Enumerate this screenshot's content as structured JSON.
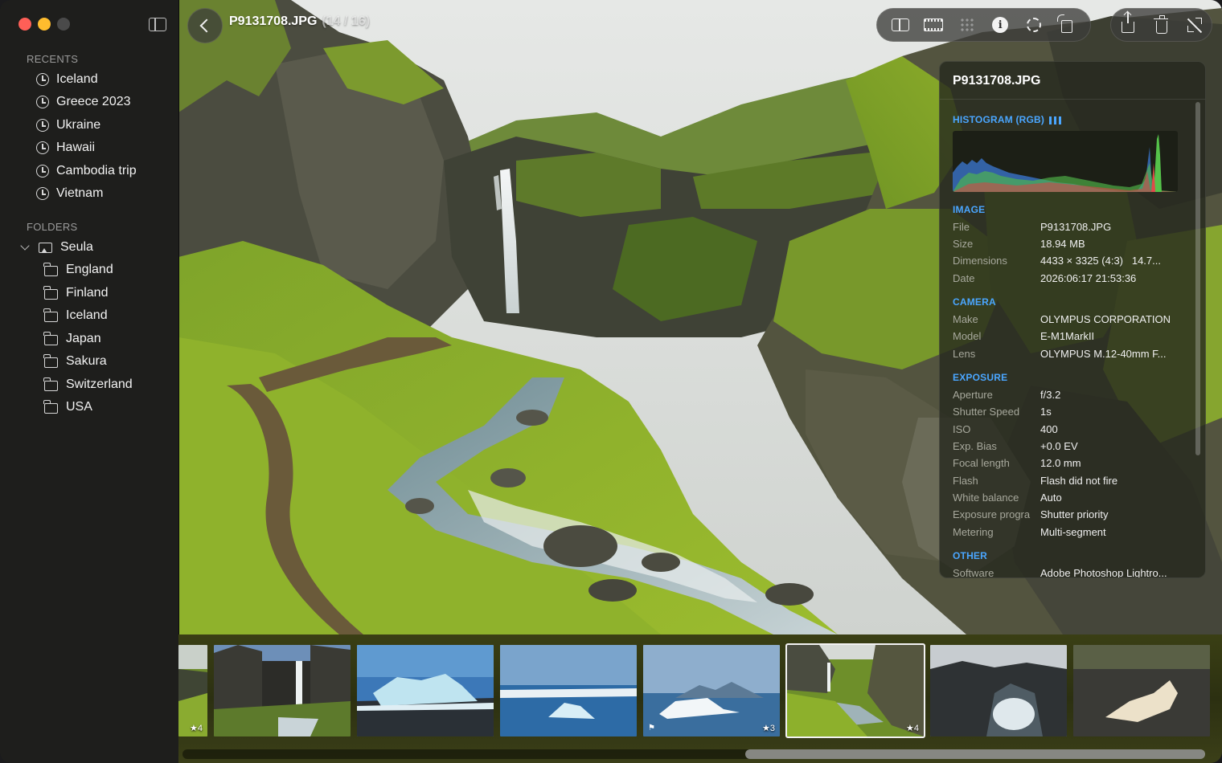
{
  "window": {
    "title": "P9131708.JPG",
    "counter": "(14 / 16)"
  },
  "sidebar": {
    "recents_title": "RECENTS",
    "recents": [
      "Iceland",
      "Greece 2023",
      "Ukraine",
      "Hawaii",
      "Cambodia trip",
      "Vietnam"
    ],
    "folders_title": "FOLDERS",
    "root_folder": "Seula",
    "folders": [
      "England",
      "Finland",
      "Iceland",
      "Japan",
      "Sakura",
      "Switzerland",
      "USA"
    ]
  },
  "toolbar": {
    "view_icons": [
      "split-view-icon",
      "filmstrip-view-icon",
      "grid-view-icon",
      "info-icon",
      "adjust-icon",
      "rotate-icon"
    ],
    "action_icons": [
      "share-icon",
      "trash-icon",
      "fullscreen-icon"
    ]
  },
  "info": {
    "filename": "P9131708.JPG",
    "histogram_title": "HISTOGRAM (RGB)",
    "image_title": "IMAGE",
    "image": [
      {
        "key": "File",
        "value": "P9131708.JPG"
      },
      {
        "key": "Size",
        "value": "18.94 MB"
      },
      {
        "key": "Dimensions",
        "value": "4433 × 3325 (4:3)   14.7..."
      },
      {
        "key": "Date",
        "value": "2026:06:17 21:53:36"
      }
    ],
    "camera_title": "CAMERA",
    "camera": [
      {
        "key": "Make",
        "value": "OLYMPUS CORPORATION"
      },
      {
        "key": "Model",
        "value": "E-M1MarkII"
      },
      {
        "key": "Lens",
        "value": "OLYMPUS M.12-40mm F..."
      }
    ],
    "exposure_title": "EXPOSURE",
    "exposure": [
      {
        "key": "Aperture",
        "value": "f/3.2"
      },
      {
        "key": "Shutter Speed",
        "value": "1s"
      },
      {
        "key": "ISO",
        "value": "400"
      },
      {
        "key": "Exp. Bias",
        "value": "+0.0 EV"
      },
      {
        "key": "Focal length",
        "value": "12.0 mm"
      },
      {
        "key": "Flash",
        "value": "Flash did not fire"
      },
      {
        "key": "White balance",
        "value": "Auto"
      },
      {
        "key": "Exposure progra",
        "value": "Shutter priority"
      },
      {
        "key": "Metering",
        "value": "Multi-segment"
      }
    ],
    "other_title": "OTHER",
    "other": [
      {
        "key": "Software",
        "value": "Adobe Photoshop Lightro..."
      }
    ]
  },
  "filmstrip": {
    "thumbs": [
      {
        "badge": "★4"
      },
      {
        "badge": ""
      },
      {
        "badge": ""
      },
      {
        "badge": ""
      },
      {
        "badge": "★3",
        "flag": "⚑"
      },
      {
        "badge": "★4",
        "selected": true
      },
      {
        "badge": ""
      },
      {
        "badge": ""
      }
    ],
    "scroll_position": 0.54
  },
  "colors": {
    "accent": "#4aa6ff",
    "sidebar_bg": "#1e1e1c",
    "traffic_red": "#fe5f57",
    "traffic_yellow": "#febc2e"
  }
}
